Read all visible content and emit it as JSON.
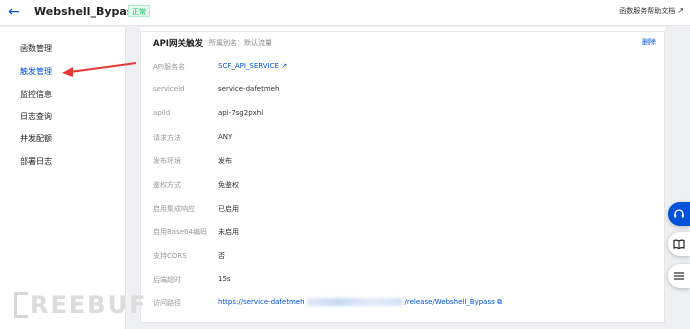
{
  "header": {
    "back_icon": "arrow-left-icon",
    "title": "Webshell_Bypass",
    "status": "正常",
    "help_link": "函数服务帮助文档",
    "help_icon": "external-link-icon"
  },
  "sidebar": {
    "items": [
      {
        "label": "函数管理",
        "active": false
      },
      {
        "label": "触发管理",
        "active": true
      },
      {
        "label": "监控信息",
        "active": false
      },
      {
        "label": "日志查询",
        "active": false
      },
      {
        "label": "并发配额",
        "active": false
      },
      {
        "label": "部署日志",
        "active": false
      }
    ]
  },
  "trigger_card": {
    "title": "API网关触发",
    "subtitle": "所属别名：默认流量",
    "delete_label": "删除",
    "rows": [
      {
        "label": "API服务名",
        "value": "SCF_API_SERVICE",
        "link": true,
        "icon": "external-link-icon"
      },
      {
        "label": "serviceId",
        "value": "service-dafetmeh"
      },
      {
        "label": "apiId",
        "value": "api-7sg2pxhl"
      },
      {
        "label": "请求方法",
        "value": "ANY"
      },
      {
        "label": "发布环境",
        "value": "发布"
      },
      {
        "label": "鉴权方式",
        "value": "免鉴权"
      },
      {
        "label": "启用集成响应",
        "value": "已启用"
      },
      {
        "label": "启用Base64编码",
        "value": "未启用"
      },
      {
        "label": "支持CORS",
        "value": "否"
      },
      {
        "label": "后端超时",
        "value": "15s"
      },
      {
        "label": "访问路径",
        "value_prefix": "https://service-dafetmeh",
        "value_suffix": "/release/Webshell_Bypass",
        "link": true,
        "icon": "copy-icon"
      }
    ]
  },
  "float_buttons": [
    "headset-icon",
    "book-icon",
    "list-icon"
  ],
  "annotation": {
    "arrow_color": "#e53935"
  },
  "watermark": {
    "text": "REEBUF"
  },
  "colors": {
    "accent": "#0052d9",
    "success": "#0abf5b",
    "annotation": "#e53935"
  }
}
